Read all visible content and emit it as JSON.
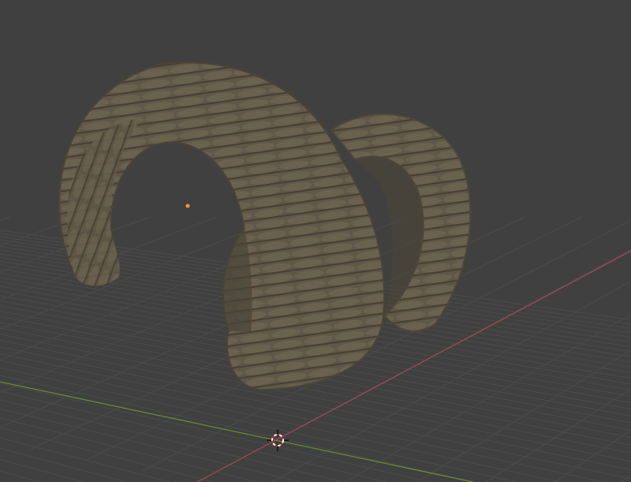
{
  "viewport": {
    "background_color": "#404040",
    "grid_color": "#4b4b4b",
    "x_axis_color": "#9a4a52",
    "y_axis_color": "#6a8a3a",
    "object_color": "#5f5747",
    "object_shadow_color": "#4a4438",
    "origin_color": "#ff9b1f"
  },
  "icons": {
    "cursor": "3d-cursor-icon",
    "origin": "object-origin-icon"
  }
}
